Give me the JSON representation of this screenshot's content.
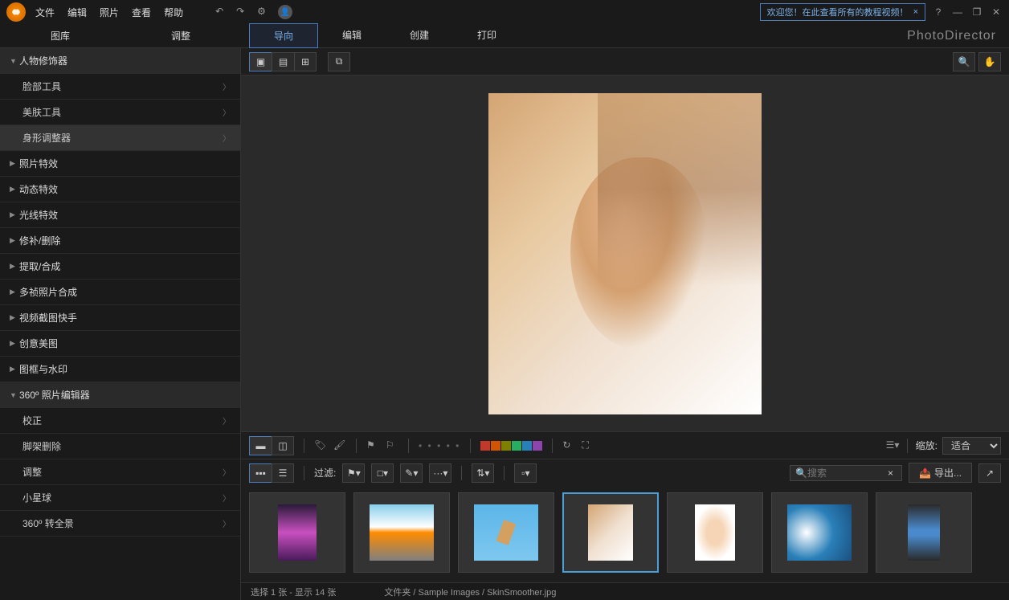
{
  "menu": {
    "file": "文件",
    "edit": "编辑",
    "photo": "照片",
    "view": "查看",
    "help": "帮助"
  },
  "welcome": "欢迎您！在此查看所有的教程视频！",
  "tabs_main": {
    "library": "图库",
    "adjust": "调整"
  },
  "tabs_nav": {
    "guided": "导向",
    "edit": "编辑",
    "create": "创建",
    "print": "打印"
  },
  "brand": "PhotoDirector",
  "sidebar": {
    "people": "人物修饰器",
    "face_tools": "脸部工具",
    "skin_tools": "美肤工具",
    "body_shaper": "身形调整器",
    "photo_fx": "照片特效",
    "dynamic_fx": "动态特效",
    "light_fx": "光线特效",
    "repair": "修补/删除",
    "extract": "提取/合成",
    "multi_comp": "多祯照片合成",
    "video_snap": "视频截图快手",
    "creative": "创意美图",
    "frame": "图框与水印",
    "editor360": "360º 照片编辑器",
    "correct": "校正",
    "tripod_remove": "脚架删除",
    "adjust": "调整",
    "little_planet": "小星球",
    "to_pano": "360º 转全景"
  },
  "filter_label": "过滤:",
  "search_placeholder": "搜索",
  "zoom_label": "缩放:",
  "zoom_value": "适合",
  "export_label": "导出...",
  "status_selection": "选择 1 张 - 显示 14 张",
  "status_folder": "文件夹",
  "status_path": "Sample Images / SkinSmoother.jpg",
  "colors": [
    "#c0392b",
    "#d35400",
    "#f1c40f",
    "#27ae60",
    "#2980b9",
    "#8e44ad"
  ]
}
